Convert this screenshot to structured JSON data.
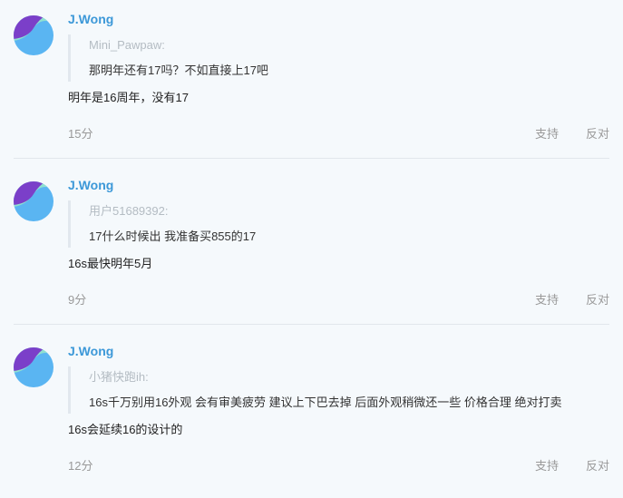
{
  "comments": [
    {
      "username": "J.Wong",
      "quote_user": "Mini_Pawpaw:",
      "quote_text": "那明年还有17吗？不如直接上17吧",
      "reply": "明年是16周年，没有17",
      "time": "15分",
      "support_label": "支持",
      "oppose_label": "反对"
    },
    {
      "username": "J.Wong",
      "quote_user": "用户51689392:",
      "quote_text": "17什么时候出 我准备买855的17",
      "reply": "16s最快明年5月",
      "time": "9分",
      "support_label": "支持",
      "oppose_label": "反对"
    },
    {
      "username": "J.Wong",
      "quote_user": "小猪快跑ih:",
      "quote_text": "16s千万别用16外观 会有审美疲劳 建议上下巴去掉 后面外观稍微还一些 价格合理 绝对打卖",
      "reply": "16s会延续16的设计的",
      "time": "12分",
      "support_label": "支持",
      "oppose_label": "反对"
    }
  ],
  "colors": {
    "username": "#3c98d8",
    "avatar_blue": "#5ab5f2",
    "avatar_purple": "#7b3fc9",
    "avatar_teal": "#8fe0d0",
    "background": "#f5f9fc"
  },
  "icons": {
    "avatar": "avatar-icon"
  }
}
